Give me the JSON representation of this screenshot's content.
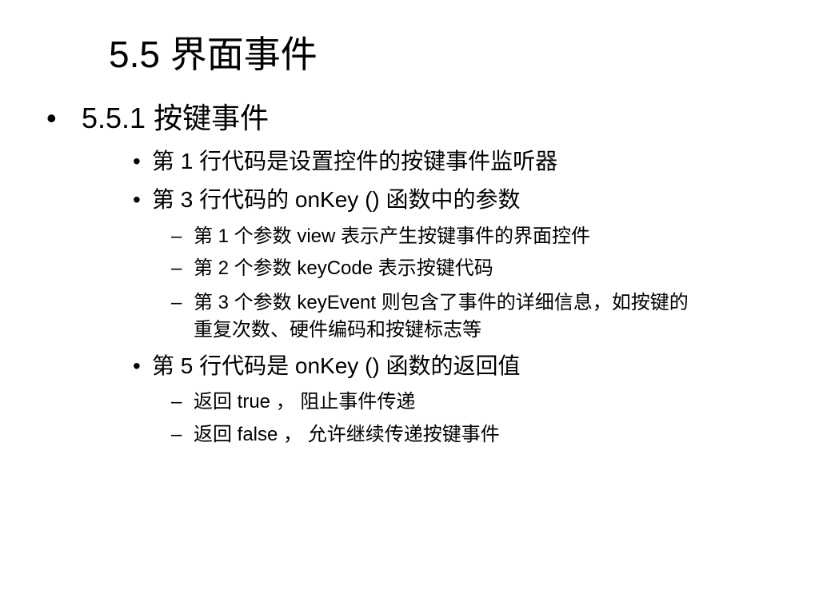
{
  "slide": {
    "title": "5.5  界面事件",
    "bullet_glyph": "•",
    "dash_glyph": "–",
    "items": {
      "h1": "5.5.1  按键事件",
      "b1": "第 1 行代码是设置控件的按键事件监听器",
      "b2": "第 3 行代码的 onKey () 函数中的参数",
      "b2_s1": "第 1 个参数 view 表示产生按键事件的界面控件",
      "b2_s2": "第 2 个参数 keyCode 表示按键代码",
      "b2_s3_line1": "第 3 个参数 keyEvent 则包含了事件的详细信息，如按键的",
      "b2_s3_line2": "重复次数、硬件编码和按键标志等",
      "b3": "第 5 行代码是 onKey () 函数的返回值",
      "b3_s1": "返回 true ， 阻止事件传递",
      "b3_s2": "返回 false ， 允许继续传递按键事件"
    }
  }
}
